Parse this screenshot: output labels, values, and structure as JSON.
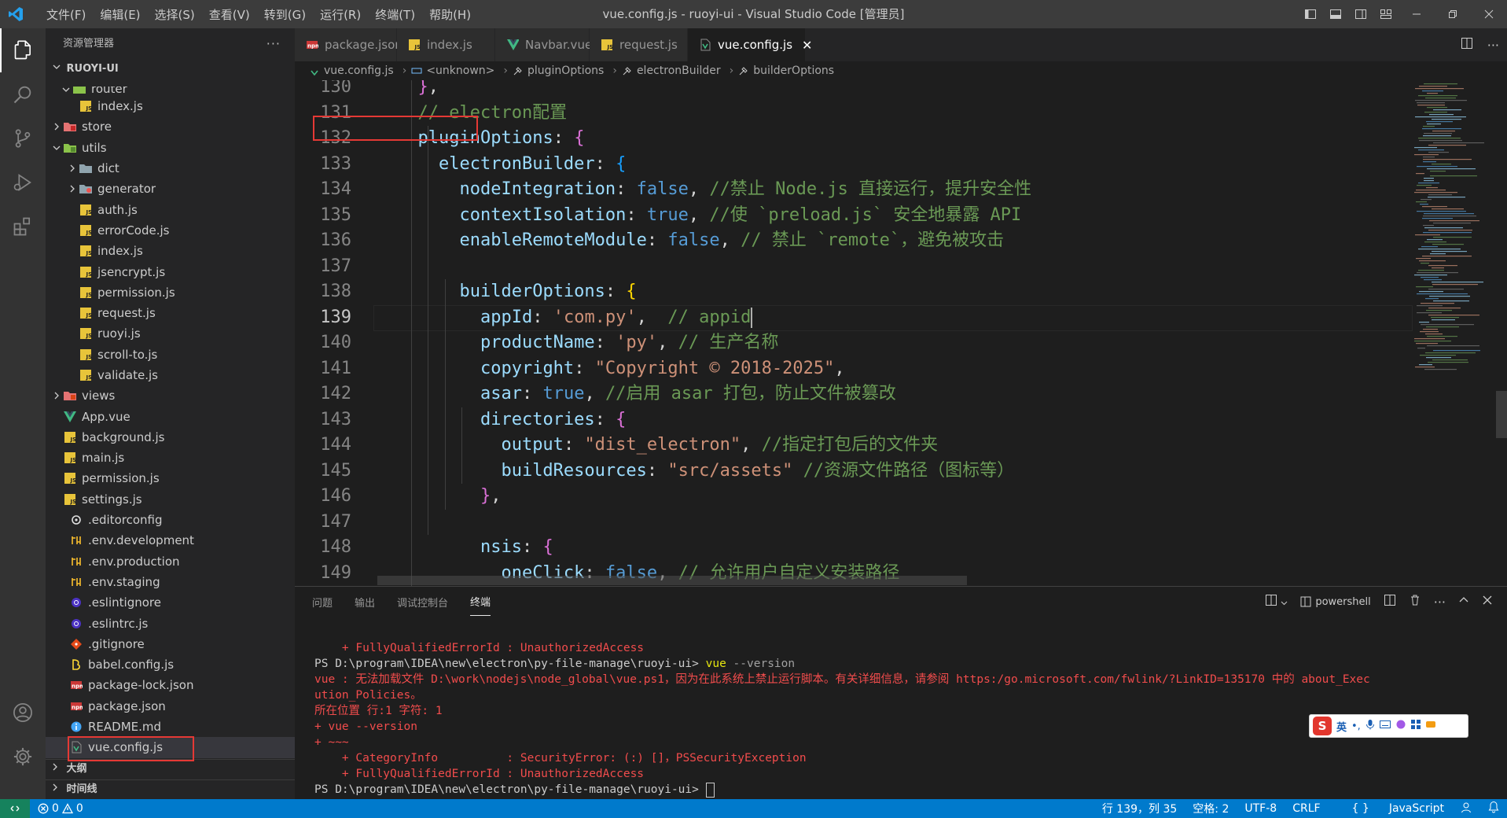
{
  "window": {
    "title": "vue.config.js - ruoyi-ui - Visual Studio Code [管理员]"
  },
  "menu": [
    "文件(F)",
    "编辑(E)",
    "选择(S)",
    "查看(V)",
    "转到(G)",
    "运行(R)",
    "终端(T)",
    "帮助(H)"
  ],
  "sidebar": {
    "title": "资源管理器",
    "root": "RUOYI-UI",
    "tree": [
      {
        "label": "router",
        "kind": "folder-partial",
        "indent": 1
      },
      {
        "label": "index.js",
        "kind": "js",
        "indent": 3
      },
      {
        "label": "store",
        "kind": "folder-store",
        "indent": 2,
        "twisty": "right"
      },
      {
        "label": "utils",
        "kind": "folder-utils",
        "indent": 2,
        "twisty": "down"
      },
      {
        "label": "dict",
        "kind": "folder",
        "indent": 3,
        "twisty": "right"
      },
      {
        "label": "generator",
        "kind": "folder-gen",
        "indent": 3,
        "twisty": "right"
      },
      {
        "label": "auth.js",
        "kind": "js",
        "indent": 3
      },
      {
        "label": "errorCode.js",
        "kind": "js",
        "indent": 3
      },
      {
        "label": "index.js",
        "kind": "js",
        "indent": 3
      },
      {
        "label": "jsencrypt.js",
        "kind": "js",
        "indent": 3
      },
      {
        "label": "permission.js",
        "kind": "js",
        "indent": 3
      },
      {
        "label": "request.js",
        "kind": "js",
        "indent": 3
      },
      {
        "label": "ruoyi.js",
        "kind": "js",
        "indent": 3
      },
      {
        "label": "scroll-to.js",
        "kind": "js",
        "indent": 3
      },
      {
        "label": "validate.js",
        "kind": "js",
        "indent": 3
      },
      {
        "label": "views",
        "kind": "folder-views",
        "indent": 2,
        "twisty": "right"
      },
      {
        "label": "App.vue",
        "kind": "vue",
        "indent": 2
      },
      {
        "label": "background.js",
        "kind": "js",
        "indent": 2
      },
      {
        "label": "main.js",
        "kind": "js",
        "indent": 2
      },
      {
        "label": "permission.js",
        "kind": "js",
        "indent": 2
      },
      {
        "label": "settings.js",
        "kind": "js",
        "indent": 2
      },
      {
        "label": ".editorconfig",
        "kind": "editorconfig",
        "indent": 1
      },
      {
        "label": ".env.development",
        "kind": "env",
        "indent": 1
      },
      {
        "label": ".env.production",
        "kind": "env",
        "indent": 1
      },
      {
        "label": ".env.staging",
        "kind": "env",
        "indent": 1
      },
      {
        "label": ".eslintignore",
        "kind": "eslint",
        "indent": 1
      },
      {
        "label": ".eslintrc.js",
        "kind": "eslint",
        "indent": 1
      },
      {
        "label": ".gitignore",
        "kind": "git",
        "indent": 1
      },
      {
        "label": "babel.config.js",
        "kind": "babel",
        "indent": 1
      },
      {
        "label": "package-lock.json",
        "kind": "npm",
        "indent": 1
      },
      {
        "label": "package.json",
        "kind": "npm",
        "indent": 1
      },
      {
        "label": "README.md",
        "kind": "info",
        "indent": 1
      },
      {
        "label": "vue.config.js",
        "kind": "vueconfig",
        "indent": 1,
        "selected": true
      }
    ],
    "outline": "大纲",
    "timeline": "时间线"
  },
  "tabs": [
    {
      "label": "package.json",
      "icon": "npm"
    },
    {
      "label": "index.js",
      "icon": "js"
    },
    {
      "label": "Navbar.vue",
      "icon": "vue"
    },
    {
      "label": "request.js",
      "icon": "js"
    },
    {
      "label": "vue.config.js",
      "icon": "vueconfig",
      "active": true
    }
  ],
  "breadcrumb": [
    "vue.config.js",
    "<unknown>",
    "pluginOptions",
    "electronBuilder",
    "builderOptions"
  ],
  "editor": {
    "current_line": "139",
    "lines": [
      {
        "n": "130",
        "tokens": [
          [
            "  ",
            "p"
          ],
          [
            "}",
            "b2"
          ],
          [
            ",",
            "p"
          ]
        ]
      },
      {
        "n": "131",
        "tokens": [
          [
            "  // electron配置",
            "com"
          ]
        ]
      },
      {
        "n": "132",
        "tokens": [
          [
            "  ",
            "p"
          ],
          [
            "pluginOptions",
            "var"
          ],
          [
            ": ",
            "p"
          ],
          [
            "{",
            "b2"
          ]
        ]
      },
      {
        "n": "133",
        "tokens": [
          [
            "    ",
            "p"
          ],
          [
            "electronBuilder",
            "var"
          ],
          [
            ": ",
            "p"
          ],
          [
            "{",
            "b3"
          ]
        ]
      },
      {
        "n": "134",
        "tokens": [
          [
            "      ",
            "p"
          ],
          [
            "nodeIntegration",
            "var"
          ],
          [
            ": ",
            "p"
          ],
          [
            "false",
            "const"
          ],
          [
            ", ",
            "p"
          ],
          [
            "//禁止 Node.js 直接运行，提升安全性",
            "com"
          ]
        ]
      },
      {
        "n": "135",
        "tokens": [
          [
            "      ",
            "p"
          ],
          [
            "contextIsolation",
            "var"
          ],
          [
            ": ",
            "p"
          ],
          [
            "true",
            "const"
          ],
          [
            ", ",
            "p"
          ],
          [
            "//使 `preload.js` 安全地暴露 API",
            "com"
          ]
        ]
      },
      {
        "n": "136",
        "tokens": [
          [
            "      ",
            "p"
          ],
          [
            "enableRemoteModule",
            "var"
          ],
          [
            ": ",
            "p"
          ],
          [
            "false",
            "const"
          ],
          [
            ", ",
            "p"
          ],
          [
            "// 禁止 `remote`，避免被攻击",
            "com"
          ]
        ]
      },
      {
        "n": "137",
        "tokens": [
          [
            "",
            "p"
          ]
        ]
      },
      {
        "n": "138",
        "tokens": [
          [
            "      ",
            "p"
          ],
          [
            "builderOptions",
            "var"
          ],
          [
            ": ",
            "p"
          ],
          [
            "{",
            "b1"
          ]
        ]
      },
      {
        "n": "139",
        "tokens": [
          [
            "        ",
            "p"
          ],
          [
            "appId",
            "var"
          ],
          [
            ": ",
            "p"
          ],
          [
            "'com.py'",
            "str"
          ],
          [
            ",  ",
            "p"
          ],
          [
            "// appid",
            "com"
          ]
        ]
      },
      {
        "n": "140",
        "tokens": [
          [
            "        ",
            "p"
          ],
          [
            "productName",
            "var"
          ],
          [
            ": ",
            "p"
          ],
          [
            "'py'",
            "str"
          ],
          [
            ", ",
            "p"
          ],
          [
            "// 生产名称",
            "com"
          ]
        ]
      },
      {
        "n": "141",
        "tokens": [
          [
            "        ",
            "p"
          ],
          [
            "copyright",
            "var"
          ],
          [
            ": ",
            "p"
          ],
          [
            "\"Copyright © 2018-2025\"",
            "str"
          ],
          [
            ",",
            "p"
          ]
        ]
      },
      {
        "n": "142",
        "tokens": [
          [
            "        ",
            "p"
          ],
          [
            "asar",
            "var"
          ],
          [
            ": ",
            "p"
          ],
          [
            "true",
            "const"
          ],
          [
            ", ",
            "p"
          ],
          [
            "//启用 asar 打包，防止文件被篡改",
            "com"
          ]
        ]
      },
      {
        "n": "143",
        "tokens": [
          [
            "        ",
            "p"
          ],
          [
            "directories",
            "var"
          ],
          [
            ": ",
            "p"
          ],
          [
            "{",
            "b2"
          ]
        ]
      },
      {
        "n": "144",
        "tokens": [
          [
            "          ",
            "p"
          ],
          [
            "output",
            "var"
          ],
          [
            ": ",
            "p"
          ],
          [
            "\"dist_electron\"",
            "str"
          ],
          [
            ", ",
            "p"
          ],
          [
            "//指定打包后的文件夹",
            "com"
          ]
        ]
      },
      {
        "n": "145",
        "tokens": [
          [
            "          ",
            "p"
          ],
          [
            "buildResources",
            "var"
          ],
          [
            ": ",
            "p"
          ],
          [
            "\"src/assets\"",
            "str"
          ],
          [
            " ",
            "p"
          ],
          [
            "//资源文件路径（图标等）",
            "com"
          ]
        ]
      },
      {
        "n": "146",
        "tokens": [
          [
            "        ",
            "p"
          ],
          [
            "}",
            "b2"
          ],
          [
            ",",
            "p"
          ]
        ]
      },
      {
        "n": "147",
        "tokens": [
          [
            "",
            "p"
          ]
        ]
      },
      {
        "n": "148",
        "tokens": [
          [
            "        ",
            "p"
          ],
          [
            "nsis",
            "var"
          ],
          [
            ": ",
            "p"
          ],
          [
            "{",
            "b2"
          ]
        ]
      },
      {
        "n": "149",
        "tokens": [
          [
            "          ",
            "p"
          ],
          [
            "oneClick",
            "var"
          ],
          [
            ": ",
            "p"
          ],
          [
            "false",
            "const"
          ],
          [
            ", ",
            "p"
          ],
          [
            "// 允许用户自定义安装路径",
            "com"
          ]
        ]
      }
    ]
  },
  "panel": {
    "tabs": [
      "问题",
      "输出",
      "调试控制台",
      "终端"
    ],
    "active_tab": "终端",
    "shell": "powershell",
    "terminal": [
      [
        [
          "    + FullyQualifiedErrorId : UnauthorizedAccess",
          "red"
        ]
      ],
      [
        [
          "PS D:\\program\\IDEA\\new\\electron\\py-file-manage\\ruoyi-ui> ",
          "white"
        ],
        [
          "vue",
          "yel"
        ],
        [
          " --version",
          "grey"
        ]
      ],
      [
        [
          "vue : 无法加载文件 D:\\work\\nodejs\\node_global\\vue.ps1，因为在此系统上禁止运行脚本。有关详细信息，请参阅 https:/go.microsoft.com/fwlink/?LinkID=135170 中的 about_Exec",
          "red"
        ]
      ],
      [
        [
          "ution_Policies。",
          "red"
        ]
      ],
      [
        [
          "所在位置 行:1 字符: 1",
          "red"
        ]
      ],
      [
        [
          "+ vue --version",
          "red"
        ]
      ],
      [
        [
          "+ ~~~",
          "red"
        ]
      ],
      [
        [
          "    + CategoryInfo          : SecurityError: (:) []，PSSecurityException",
          "red"
        ]
      ],
      [
        [
          "    + FullyQualifiedErrorId : UnauthorizedAccess",
          "red"
        ]
      ],
      [
        [
          "PS D:\\program\\IDEA\\new\\electron\\py-file-manage\\ruoyi-ui> ",
          "white"
        ]
      ]
    ]
  },
  "ime": {
    "lang": "英"
  },
  "status": {
    "errors": "0",
    "warnings": "0",
    "position": "行 139，列 35",
    "spaces": "空格: 2",
    "encoding": "UTF-8",
    "eol": "CRLF",
    "language": "JavaScript"
  }
}
